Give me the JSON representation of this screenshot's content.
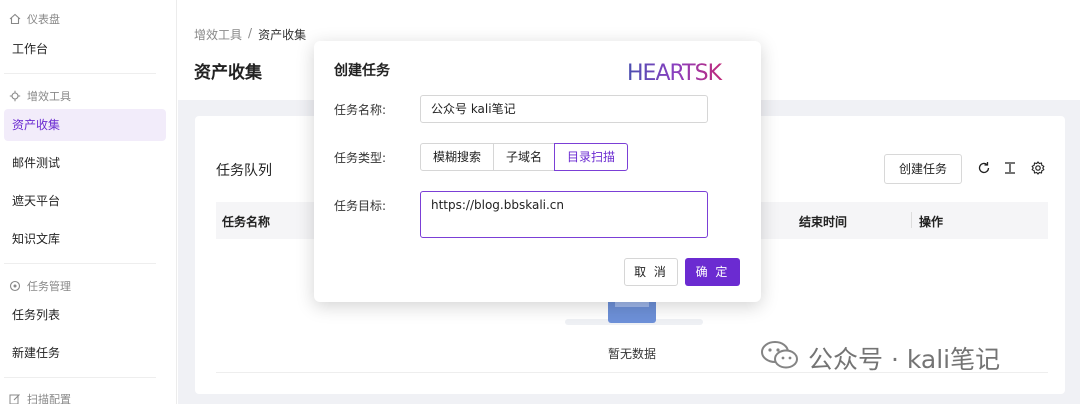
{
  "sidebar": {
    "groups": [
      {
        "label": "仪表盘",
        "icon": "home-icon"
      },
      {
        "label": "增效工具",
        "icon": "tool-icon"
      },
      {
        "label": "任务管理",
        "icon": "target-icon"
      },
      {
        "label": "扫描配置",
        "icon": "edit-icon"
      }
    ],
    "items": [
      {
        "label": "工作台"
      },
      {
        "label": "资产收集"
      },
      {
        "label": "邮件测试"
      },
      {
        "label": "遮天平台"
      },
      {
        "label": "知识文库"
      },
      {
        "label": "任务列表"
      },
      {
        "label": "新建任务"
      }
    ]
  },
  "breadcrumb": {
    "parent": "增效工具",
    "separator": "/",
    "current": "资产收集"
  },
  "page_title": "资产收集",
  "queue": {
    "title": "任务队列",
    "create_button": "创建任务",
    "columns": [
      "任务名称",
      "结束时间",
      "操作"
    ],
    "empty_text": "暂无数据"
  },
  "modal": {
    "title": "创建任务",
    "logo_text": "HEARTSK",
    "name_label": "任务名称:",
    "name_value": "公众号 kali笔记",
    "type_label": "任务类型:",
    "type_options": [
      "模糊搜索",
      "子域名",
      "目录扫描"
    ],
    "type_selected": "目录扫描",
    "target_label": "任务目标:",
    "target_value": "https://blog.bbskali.cn",
    "cancel": "取 消",
    "ok": "确 定"
  },
  "watermark": "公众号 · kali笔记",
  "colors": {
    "accent": "#6b2bd1",
    "active_bg": "#f2ecfa"
  }
}
